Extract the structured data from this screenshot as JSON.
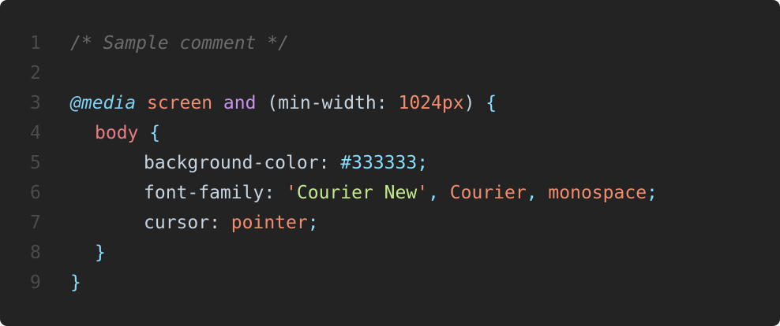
{
  "editor": {
    "lines": [
      {
        "number": "1",
        "tokens": [
          {
            "text": "/* Sample comment */",
            "kind": "comment"
          }
        ]
      },
      {
        "number": "2",
        "tokens": []
      },
      {
        "number": "3",
        "tokens": [
          {
            "text": "@media",
            "kind": "atrule"
          },
          {
            "text": " ",
            "kind": "plain"
          },
          {
            "text": "screen",
            "kind": "value"
          },
          {
            "text": " ",
            "kind": "plain"
          },
          {
            "text": "and",
            "kind": "keyword"
          },
          {
            "text": " (",
            "kind": "plain"
          },
          {
            "text": "min-width",
            "kind": "prop"
          },
          {
            "text": ": ",
            "kind": "plain"
          },
          {
            "text": "1024px",
            "kind": "value"
          },
          {
            "text": ") ",
            "kind": "plain"
          },
          {
            "text": "{",
            "kind": "punct"
          }
        ]
      },
      {
        "number": "4",
        "indent": 1,
        "tokens": [
          {
            "text": "body",
            "kind": "selector"
          },
          {
            "text": " ",
            "kind": "plain"
          },
          {
            "text": "{",
            "kind": "punct"
          }
        ]
      },
      {
        "number": "5",
        "indent": 2,
        "tokens": [
          {
            "text": "background-color",
            "kind": "prop"
          },
          {
            "text": ": ",
            "kind": "plain"
          },
          {
            "text": "#333333",
            "kind": "hex"
          },
          {
            "text": ";",
            "kind": "punct"
          }
        ]
      },
      {
        "number": "6",
        "indent": 2,
        "tokens": [
          {
            "text": "font-family",
            "kind": "prop"
          },
          {
            "text": ": ",
            "kind": "plain"
          },
          {
            "text": "'",
            "kind": "stringq"
          },
          {
            "text": "Courier New",
            "kind": "string"
          },
          {
            "text": "'",
            "kind": "stringq"
          },
          {
            "text": ", ",
            "kind": "punct"
          },
          {
            "text": "Courier",
            "kind": "value"
          },
          {
            "text": ", ",
            "kind": "punct"
          },
          {
            "text": "monospace",
            "kind": "value"
          },
          {
            "text": ";",
            "kind": "punct"
          }
        ]
      },
      {
        "number": "7",
        "indent": 2,
        "tokens": [
          {
            "text": "cursor",
            "kind": "prop"
          },
          {
            "text": ": ",
            "kind": "plain"
          },
          {
            "text": "pointer",
            "kind": "value"
          },
          {
            "text": ";",
            "kind": "punct"
          }
        ]
      },
      {
        "number": "8",
        "indent": 1,
        "tokens": [
          {
            "text": "}",
            "kind": "punct"
          }
        ]
      },
      {
        "number": "9",
        "tokens": [
          {
            "text": "}",
            "kind": "punct"
          }
        ]
      }
    ]
  },
  "colors": {
    "background": "#232323",
    "line_number": "#4b4b4b",
    "comment": "#6c6c6c",
    "atrule": "#7fd1f3",
    "keyword": "#c792ea",
    "value": "#f08d6e",
    "selector": "#e87c82",
    "punctuation": "#89ddff",
    "property": "#c5d3df",
    "string": "#c3e88d"
  }
}
